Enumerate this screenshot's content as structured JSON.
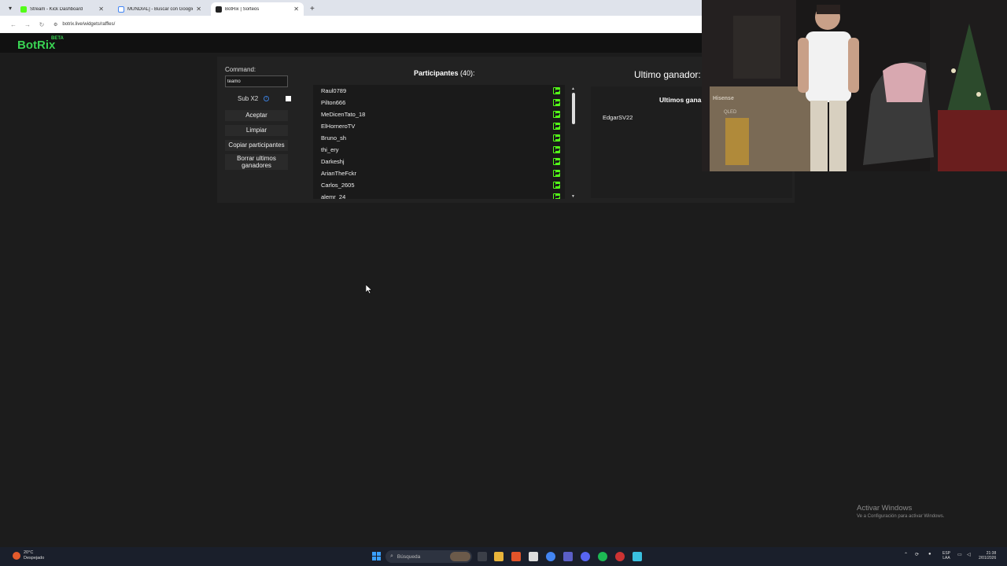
{
  "browser": {
    "tabs": [
      {
        "title": "Stream - Kick Dashboard",
        "favicon_color": "#53fc18"
      },
      {
        "title": "MUNDIAL] - Buscar con Google",
        "favicon_color": "#4285f4"
      },
      {
        "title": "BotRix | Sorteos",
        "favicon_color": "#222222"
      }
    ],
    "url": "botrix.live/widgets/raffles/"
  },
  "site": {
    "logo": "BotRix",
    "logo_badge": "BETA",
    "accent": "#39d353"
  },
  "controls": {
    "command_label": "Command:",
    "command_value": "teamo",
    "sub_label": "Sub X2",
    "buttons": {
      "accept": "Aceptar",
      "clear": "Limpiar",
      "copy": "Copiar participantes",
      "delete_winners": "Borrar ultimos ganadores"
    }
  },
  "participants": {
    "title": "Participantes",
    "count": "(40):",
    "platform_icon": "kick-icon",
    "items": [
      "Raul0789",
      "Pilton666",
      "MeDicenTato_18",
      "ElHorneroTV",
      "Bruno_sh",
      "thi_ery",
      "Darkeshj",
      "ArianTheFckr",
      "Carlos_2605",
      "alemr_24"
    ]
  },
  "winner": {
    "title": "Ultimo ganador:",
    "recent_title": "Ultimos gana",
    "recent": [
      "EdgarSV22"
    ]
  },
  "webcam": {
    "sign_brand": "Hisense",
    "sign_model": "QLED"
  },
  "watermark": {
    "line1": "Activar Windows",
    "line2": "Ve a Configuración para activar Windows."
  },
  "taskbar": {
    "weather_temp": "20°C",
    "weather_desc": "Despejado",
    "search_placeholder": "Búsqueda",
    "lang_line1": "ESP",
    "lang_line2": "LAA",
    "time": "21:38",
    "date": "2/01/2026"
  }
}
